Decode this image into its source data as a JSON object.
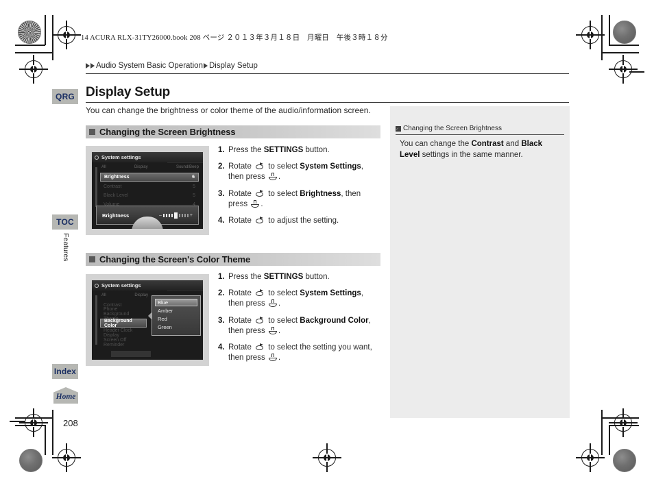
{
  "print_header": "14 ACURA RLX-31TY26000.book  208 ページ  ２０１３年３月１８日　月曜日　午後３時１８分",
  "breadcrumb": {
    "parent": "Audio System Basic Operation",
    "current": "Display Setup"
  },
  "side_tabs": {
    "qrg": "QRG",
    "toc": "TOC",
    "features": "Features",
    "index": "Index",
    "home": "Home"
  },
  "page": {
    "title": "Display Setup",
    "intro": "You can change the brightness or color theme of the audio/information screen.",
    "number": "208"
  },
  "sections": [
    {
      "heading": "Changing the Screen Brightness",
      "steps": [
        {
          "num": "1.",
          "pre": "Press the ",
          "bold": "SETTINGS",
          "post": " button."
        },
        {
          "num": "2.",
          "pre": "Rotate ",
          "mid": " to select ",
          "bold": "System Settings",
          "post": ", then press ",
          "tail": "."
        },
        {
          "num": "3.",
          "pre": "Rotate ",
          "mid": " to select ",
          "bold": "Brightness",
          "post": ", then press ",
          "tail": "."
        },
        {
          "num": "4.",
          "pre": "Rotate ",
          "mid": " to adjust the setting.",
          "bold": "",
          "post": "",
          "tail": ""
        }
      ]
    },
    {
      "heading": "Changing the Screen's Color Theme",
      "steps": [
        {
          "num": "1.",
          "pre": "Press the ",
          "bold": "SETTINGS",
          "post": " button."
        },
        {
          "num": "2.",
          "pre": "Rotate ",
          "mid": " to select ",
          "bold": "System Settings",
          "post": ", then press ",
          "tail": "."
        },
        {
          "num": "3.",
          "pre": "Rotate ",
          "mid": " to select ",
          "bold": "Background Color",
          "post": ", then press ",
          "tail": "."
        },
        {
          "num": "4.",
          "pre": "Rotate ",
          "mid": " to select the setting you want, then press ",
          "bold": "",
          "post": "",
          "tail": "."
        }
      ]
    }
  ],
  "figure_1": {
    "screen_title": "System settings",
    "col_labels": {
      "left": "All",
      "mid": "Display",
      "right": "Sound/Beep"
    },
    "rows": [
      {
        "label": "Brightness",
        "value": "6",
        "selected": true
      },
      {
        "label": "Contrast",
        "value": "5",
        "selected": false
      },
      {
        "label": "Black Level",
        "value": "5",
        "selected": false
      },
      {
        "label": "Volume",
        "value": "4",
        "selected": false
      }
    ],
    "slider_label": "Brightness",
    "slider_minus": "–",
    "slider_plus": "+"
  },
  "figure_2": {
    "screen_title": "System settings",
    "col_labels": {
      "left": "All",
      "mid": "Display"
    },
    "rows": [
      {
        "label": "Contrast",
        "selected": false
      },
      {
        "label": "Phone Background Theme",
        "selected": false
      },
      {
        "label": "Background Color",
        "selected": true
      },
      {
        "label": "Header Clock Display",
        "selected": false
      },
      {
        "label": "Screen Off Reminder",
        "selected": false
      }
    ],
    "popup_options": [
      {
        "label": "Blue",
        "selected": true
      },
      {
        "label": "Amber",
        "selected": false
      },
      {
        "label": "Red",
        "selected": false
      },
      {
        "label": "Green",
        "selected": false
      }
    ]
  },
  "note": {
    "heading": "Changing the Screen Brightness",
    "pre": "You can change the ",
    "bold_1": "Contrast",
    "mid": " and ",
    "bold_2": "Black Level",
    "post": " settings in the same manner."
  }
}
